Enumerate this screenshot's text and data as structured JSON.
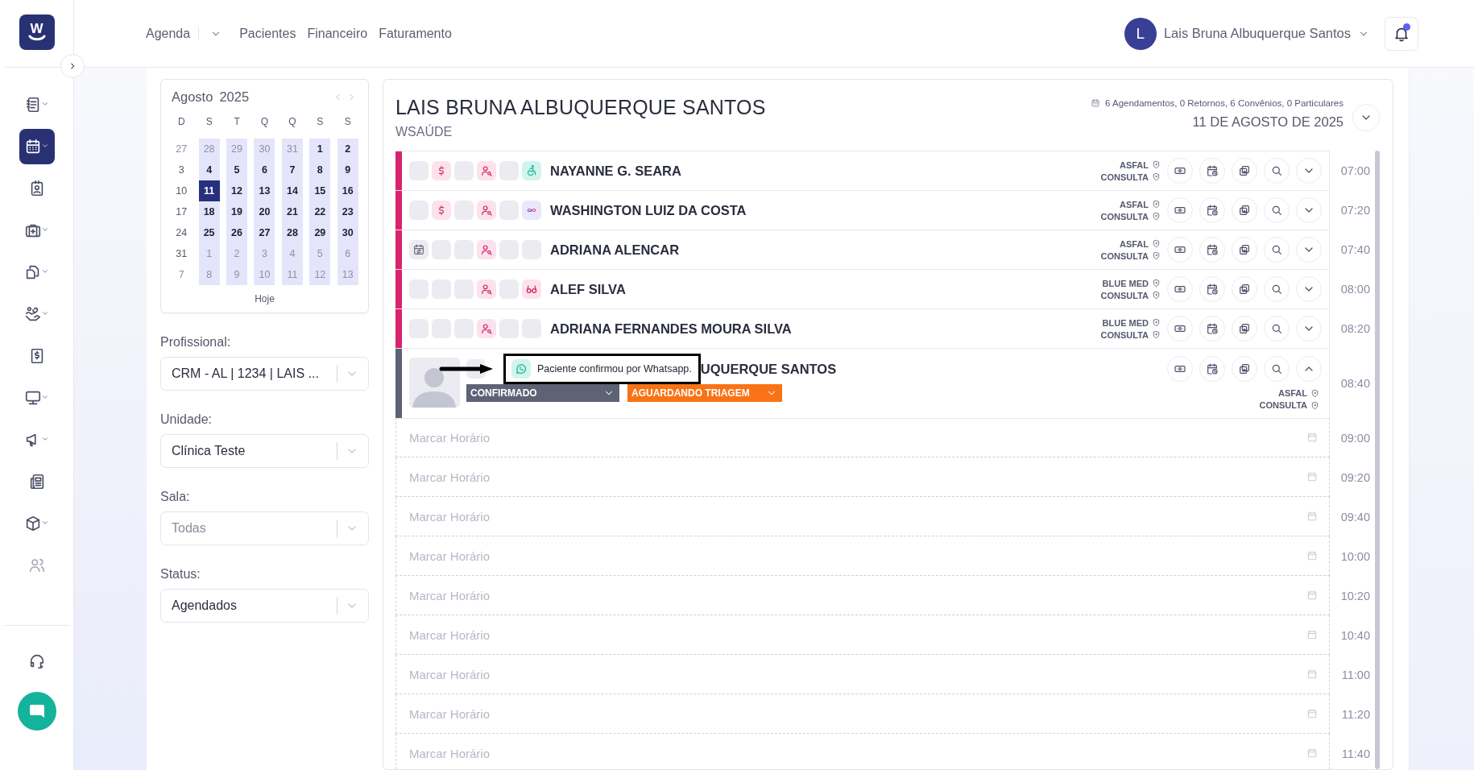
{
  "sidebar": {
    "logo": "W",
    "items": [
      {
        "kind": "records",
        "expandable": true,
        "selected": false,
        "disabled": false
      },
      {
        "kind": "calendar",
        "expandable": true,
        "selected": true,
        "disabled": false
      },
      {
        "kind": "badge",
        "expandable": false,
        "selected": false,
        "disabled": false
      },
      {
        "kind": "medkit",
        "expandable": true,
        "selected": false,
        "disabled": false
      },
      {
        "kind": "files",
        "expandable": true,
        "selected": false,
        "disabled": false
      },
      {
        "kind": "care",
        "expandable": true,
        "selected": false,
        "disabled": false
      },
      {
        "kind": "invoice",
        "expandable": false,
        "selected": false,
        "disabled": false
      },
      {
        "kind": "monitor",
        "expandable": true,
        "selected": false,
        "disabled": false
      },
      {
        "kind": "megaphone",
        "expandable": true,
        "selected": false,
        "disabled": false
      },
      {
        "kind": "news",
        "expandable": false,
        "selected": false,
        "disabled": false
      },
      {
        "kind": "box",
        "expandable": true,
        "selected": false,
        "disabled": false
      },
      {
        "kind": "people",
        "expandable": false,
        "selected": false,
        "disabled": true
      }
    ]
  },
  "header": {
    "nav": [
      {
        "label": "Agenda",
        "dropdown": true
      },
      {
        "label": "Pacientes",
        "dropdown": false
      },
      {
        "label": "Financeiro",
        "dropdown": false
      },
      {
        "label": "Faturamento",
        "dropdown": false
      }
    ],
    "user": {
      "initial": "L",
      "name": "Lais Bruna Albuquerque Santos"
    },
    "notifications": {
      "unread": true
    }
  },
  "calendar": {
    "month": "Agosto",
    "year": "2025",
    "today_button": "Hoje",
    "weekdays": [
      {
        "label": "D",
        "available": false
      },
      {
        "label": "S",
        "available": true
      },
      {
        "label": "T",
        "available": true
      },
      {
        "label": "Q",
        "available": true
      },
      {
        "label": "Q",
        "available": true
      },
      {
        "label": "S",
        "available": true
      },
      {
        "label": "S",
        "available": true
      }
    ],
    "weeks": [
      [
        {
          "day": "27",
          "outside": true,
          "selected": false
        },
        {
          "day": "28",
          "outside": true,
          "selected": false
        },
        {
          "day": "29",
          "outside": true,
          "selected": false
        },
        {
          "day": "30",
          "outside": true,
          "selected": false
        },
        {
          "day": "31",
          "outside": true,
          "selected": false
        },
        {
          "day": "1",
          "outside": false,
          "selected": false
        },
        {
          "day": "2",
          "outside": false,
          "selected": false
        }
      ],
      [
        {
          "day": "3",
          "outside": false,
          "selected": false
        },
        {
          "day": "4",
          "outside": false,
          "selected": false
        },
        {
          "day": "5",
          "outside": false,
          "selected": false
        },
        {
          "day": "6",
          "outside": false,
          "selected": false
        },
        {
          "day": "7",
          "outside": false,
          "selected": false
        },
        {
          "day": "8",
          "outside": false,
          "selected": false
        },
        {
          "day": "9",
          "outside": false,
          "selected": false
        }
      ],
      [
        {
          "day": "10",
          "outside": false,
          "selected": false
        },
        {
          "day": "11",
          "outside": false,
          "selected": true
        },
        {
          "day": "12",
          "outside": false,
          "selected": false
        },
        {
          "day": "13",
          "outside": false,
          "selected": false
        },
        {
          "day": "14",
          "outside": false,
          "selected": false
        },
        {
          "day": "15",
          "outside": false,
          "selected": false
        },
        {
          "day": "16",
          "outside": false,
          "selected": false
        }
      ],
      [
        {
          "day": "17",
          "outside": false,
          "selected": false
        },
        {
          "day": "18",
          "outside": false,
          "selected": false
        },
        {
          "day": "19",
          "outside": false,
          "selected": false
        },
        {
          "day": "20",
          "outside": false,
          "selected": false
        },
        {
          "day": "21",
          "outside": false,
          "selected": false
        },
        {
          "day": "22",
          "outside": false,
          "selected": false
        },
        {
          "day": "23",
          "outside": false,
          "selected": false
        }
      ],
      [
        {
          "day": "24",
          "outside": false,
          "selected": false
        },
        {
          "day": "25",
          "outside": false,
          "selected": false
        },
        {
          "day": "26",
          "outside": false,
          "selected": false
        },
        {
          "day": "27",
          "outside": false,
          "selected": false
        },
        {
          "day": "28",
          "outside": false,
          "selected": false
        },
        {
          "day": "29",
          "outside": false,
          "selected": false
        },
        {
          "day": "30",
          "outside": false,
          "selected": false
        }
      ],
      [
        {
          "day": "31",
          "outside": false,
          "selected": false
        },
        {
          "day": "1",
          "outside": true,
          "selected": false
        },
        {
          "day": "2",
          "outside": true,
          "selected": false
        },
        {
          "day": "3",
          "outside": true,
          "selected": false
        },
        {
          "day": "4",
          "outside": true,
          "selected": false
        },
        {
          "day": "5",
          "outside": true,
          "selected": false
        },
        {
          "day": "6",
          "outside": true,
          "selected": false
        }
      ],
      [
        {
          "day": "7",
          "outside": true,
          "selected": false
        },
        {
          "day": "8",
          "outside": true,
          "selected": false
        },
        {
          "day": "9",
          "outside": true,
          "selected": false
        },
        {
          "day": "10",
          "outside": true,
          "selected": false
        },
        {
          "day": "11",
          "outside": true,
          "selected": false
        },
        {
          "day": "12",
          "outside": true,
          "selected": false
        },
        {
          "day": "13",
          "outside": true,
          "selected": false
        }
      ]
    ]
  },
  "filters": [
    {
      "label": "Profissional:",
      "value": "CRM - AL | 1234 | LAIS ..."
    },
    {
      "label": "Unidade:",
      "value": "Clínica Teste"
    },
    {
      "label": "Sala:",
      "placeholder": "Todas"
    },
    {
      "label": "Status:",
      "value": "Agendados"
    }
  ],
  "agenda": {
    "title": "LAIS BRUNA ALBUQUERQUE SANTOS",
    "subtitle": "WSAÚDE",
    "summary": "6 Agendamentos, 0 Retornos, 6 Convênios, 0 Particulares",
    "date": "11 DE AGOSTO DE 2025",
    "appointments": [
      {
        "time": "07:00",
        "name": "NAYANNE G. SEARA",
        "color": "#d6246e",
        "insurance": "ASFAL",
        "procedure": "CONSULTA",
        "expanded": false,
        "flags": [
          {
            "kind": "empty"
          },
          {
            "kind": "payment"
          },
          {
            "kind": "empty"
          },
          {
            "kind": "patient"
          },
          {
            "kind": "empty"
          },
          {
            "kind": "accessibility"
          }
        ]
      },
      {
        "time": "07:20",
        "name": "WASHINGTON LUIZ DA COSTA",
        "color": "#d6246e",
        "insurance": "ASFAL",
        "procedure": "CONSULTA",
        "expanded": false,
        "flags": [
          {
            "kind": "empty"
          },
          {
            "kind": "payment"
          },
          {
            "kind": "empty"
          },
          {
            "kind": "patient"
          },
          {
            "kind": "empty"
          },
          {
            "kind": "infinity"
          }
        ]
      },
      {
        "time": "07:40",
        "name": "ADRIANA ALENCAR",
        "color": "#d6246e",
        "insurance": "ASFAL",
        "procedure": "CONSULTA",
        "expanded": false,
        "flags": [
          {
            "kind": "reschedule"
          },
          {
            "kind": "empty"
          },
          {
            "kind": "empty"
          },
          {
            "kind": "patient"
          },
          {
            "kind": "empty"
          },
          {
            "kind": "empty"
          }
        ]
      },
      {
        "time": "08:00",
        "name": "ALEF SILVA",
        "color": "#d6246e",
        "insurance": "BLUE MED",
        "procedure": "CONSULTA",
        "expanded": false,
        "flags": [
          {
            "kind": "empty"
          },
          {
            "kind": "empty"
          },
          {
            "kind": "empty"
          },
          {
            "kind": "patient"
          },
          {
            "kind": "empty"
          },
          {
            "kind": "glasses"
          }
        ]
      },
      {
        "time": "08:20",
        "name": "ADRIANA FERNANDES MOURA SILVA",
        "color": "#d6246e",
        "insurance": "BLUE MED",
        "procedure": "CONSULTA",
        "expanded": false,
        "flags": [
          {
            "kind": "empty"
          },
          {
            "kind": "empty"
          },
          {
            "kind": "empty"
          },
          {
            "kind": "patient"
          },
          {
            "kind": "empty"
          },
          {
            "kind": "empty"
          }
        ]
      },
      {
        "time": "08:40",
        "name": "UQUERQUE SANTOS",
        "color": "#5e6275",
        "insurance": "ASFAL",
        "procedure": "CONSULTA",
        "expanded": true,
        "flags": [
          {
            "kind": "empty"
          }
        ],
        "tooltip": "Paciente confirmou por Whatsapp.",
        "confirmation": "CONFIRMADO",
        "stage": "AGUARDANDO TRIAGEM"
      }
    ],
    "free_slots": [
      {
        "time": "09:00",
        "label": "Marcar Horário"
      },
      {
        "time": "09:20",
        "label": "Marcar Horário"
      },
      {
        "time": "09:40",
        "label": "Marcar Horário"
      },
      {
        "time": "10:00",
        "label": "Marcar Horário"
      },
      {
        "time": "10:20",
        "label": "Marcar Horário"
      },
      {
        "time": "10:40",
        "label": "Marcar Horário"
      },
      {
        "time": "11:00",
        "label": "Marcar Horário"
      },
      {
        "time": "11:20",
        "label": "Marcar Horário"
      },
      {
        "time": "11:40",
        "label": "Marcar Horário"
      }
    ]
  }
}
